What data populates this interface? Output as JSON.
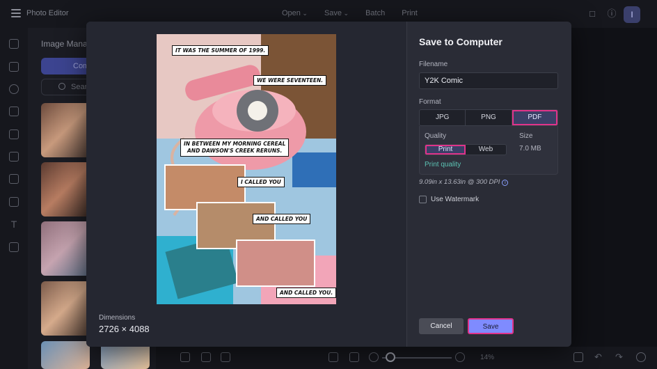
{
  "app": {
    "title": "Photo Editor",
    "menu": [
      "Open",
      "Save",
      "Batch",
      "Print"
    ],
    "avatar_initial": "I"
  },
  "panel": {
    "title": "Image Mana",
    "tab_label": "Com",
    "search_placeholder": "Sear"
  },
  "bottom": {
    "zoom": "14%"
  },
  "modal": {
    "title": "Save to Computer",
    "filename_label": "Filename",
    "filename_value": "Y2K Comic",
    "format_label": "Format",
    "formats": [
      "JPG",
      "PNG",
      "PDF"
    ],
    "selected_format": "PDF",
    "quality_label": "Quality",
    "quality_options": [
      "Print",
      "Web"
    ],
    "selected_quality": "Print",
    "size_label": "Size",
    "size_value": "7.0 MB",
    "print_quality_link": "Print quality",
    "resolution": "9.09in x 13.63in @ 300 DPI",
    "watermark_label": "Use Watermark",
    "watermark_checked": false,
    "cancel_label": "Cancel",
    "save_label": "Save",
    "dimensions_label": "Dimensions",
    "dimensions_value": "2726 × 4088"
  },
  "comic": {
    "captions": [
      "IT WAS THE SUMMER OF 1999.",
      "WE WERE SEVENTEEN.",
      "IN BETWEEN MY MORNING CEREAL",
      "AND DAWSON'S CREEK RERUNS.",
      "I CALLED YOU",
      "AND CALLED YOU",
      "AND CALLED YOU."
    ]
  }
}
